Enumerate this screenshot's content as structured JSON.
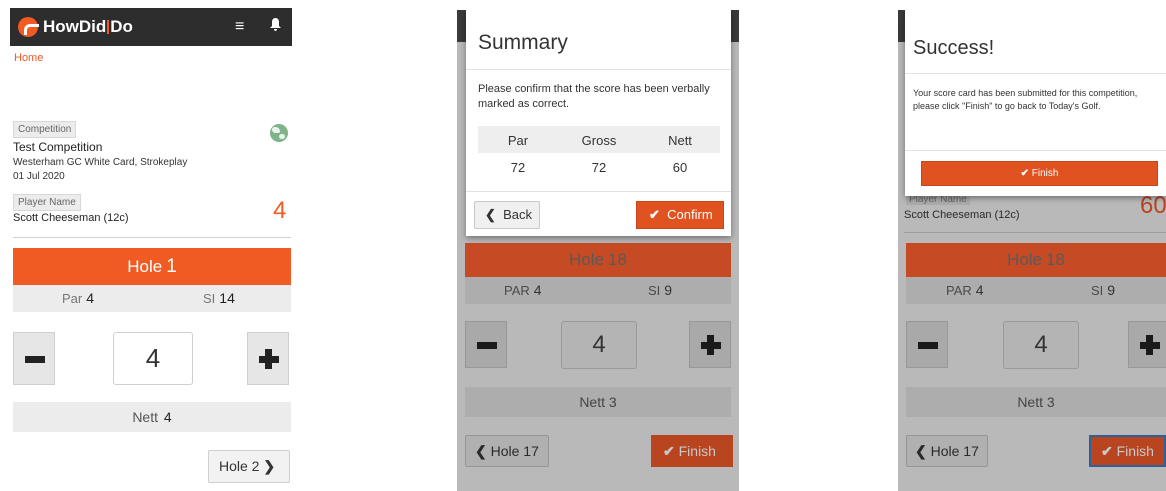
{
  "panel1": {
    "app_title_a": "HowDid",
    "app_title_b": "Do",
    "menu_icon": "≡",
    "bell_icon": "🔔",
    "home_link": "Home",
    "competition_tag": "Competition",
    "competition_name": "Test Competition",
    "course": "Westerham GC White Card, Strokeplay",
    "date": "01 Jul 2020",
    "player_tag": "Player Name",
    "player_name": "Scott Cheeseman (12c)",
    "player_score": "4",
    "hole_label": "Hole",
    "hole_number": "1",
    "par_label": "Par",
    "par_value": "4",
    "si_label": "SI",
    "si_value": "14",
    "score_value": "4",
    "nett_label": "Nett",
    "nett_value": "4",
    "next_hole_label": "Hole 2"
  },
  "panel2": {
    "modal": {
      "title": "Summary",
      "message": "Please confirm that the score has been verbally marked as correct.",
      "headers": [
        "Par",
        "Gross",
        "Nett"
      ],
      "values": [
        "72",
        "72",
        "60"
      ],
      "back_label": "Back",
      "confirm_label": "Confirm"
    },
    "bg": {
      "hole_label": "Hole",
      "hole_number": "18",
      "par_label": "PAR",
      "par_value": "4",
      "si_label": "SI",
      "si_value": "9",
      "score_value": "4",
      "nett_label": "Nett",
      "nett_value": "3",
      "prev_hole_label": "Hole 17",
      "finish_label": "Finish"
    }
  },
  "panel3": {
    "modal": {
      "title": "Success!",
      "message": "Your score card has been submitted for this competition, please click \"Finish\" to go back to Today's Golf.",
      "finish_label": "Finish"
    },
    "bg": {
      "player_tag": "Player Name",
      "player_name": "Scott Cheeseman (12c)",
      "player_score": "60",
      "hole_label": "Hole",
      "hole_number": "18",
      "par_label": "PAR",
      "par_value": "4",
      "si_label": "SI",
      "si_value": "9",
      "score_value": "4",
      "nett_label": "Nett",
      "nett_value": "3",
      "prev_hole_label": "Hole 17",
      "finish_label": "Finish"
    }
  },
  "colors": {
    "brand_orange": "#f05a23",
    "topbar": "#2d2d2d",
    "dim_overlay": "#b9b9b9"
  }
}
